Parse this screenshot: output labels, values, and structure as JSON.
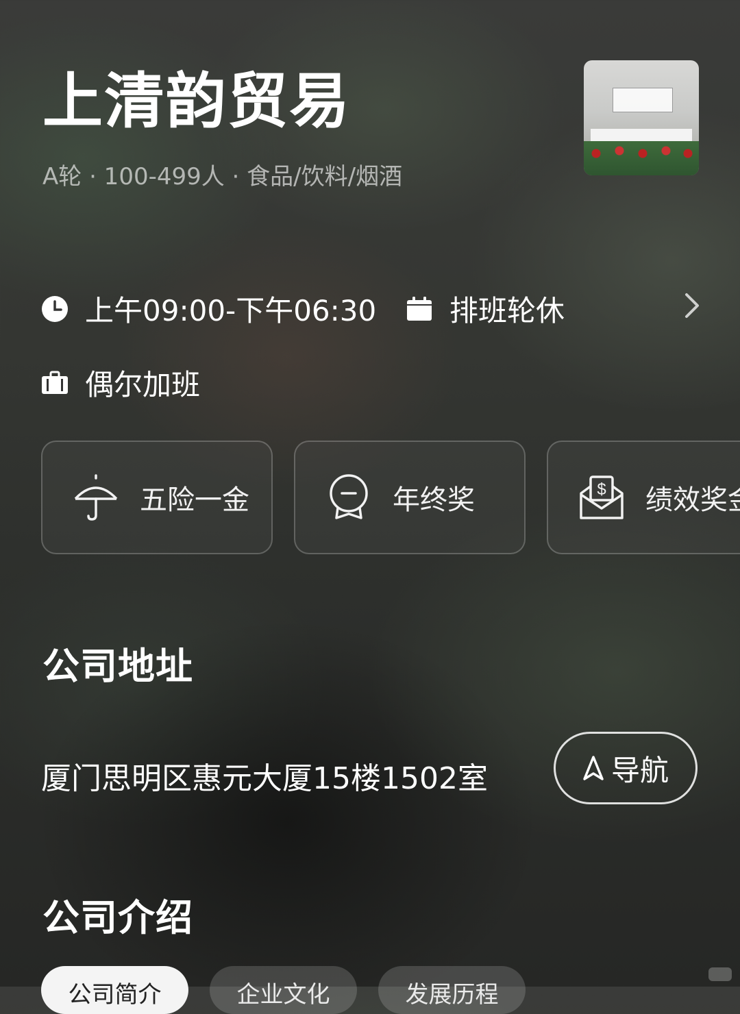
{
  "company": {
    "name": "上清韵贸易",
    "meta": "A轮 · 100-499人 · 食品/饮料/烟酒"
  },
  "work_info": {
    "hours": "上午09:00-下午06:30",
    "shift": "排班轮休",
    "overtime": "偶尔加班"
  },
  "benefits": [
    {
      "label": "五险一金",
      "icon": "umbrella-icon"
    },
    {
      "label": "年终奖",
      "icon": "medal-icon"
    },
    {
      "label": "绩效奖金",
      "icon": "money-envelope-icon"
    }
  ],
  "address_section": {
    "title": "公司地址",
    "address": "厦门思明区惠元大厦15楼1502室",
    "nav_label": "导航"
  },
  "intro_section": {
    "title": "公司介绍",
    "tabs": [
      {
        "label": "公司简介",
        "active": true
      },
      {
        "label": "企业文化",
        "active": false
      },
      {
        "label": "发展历程",
        "active": false
      }
    ]
  },
  "colors": {
    "text": "#ffffff",
    "subtext": "rgba(255,255,255,0.62)",
    "card_border": "rgba(255,255,255,0.22)",
    "tab_active_bg": "#f4f4f4"
  }
}
